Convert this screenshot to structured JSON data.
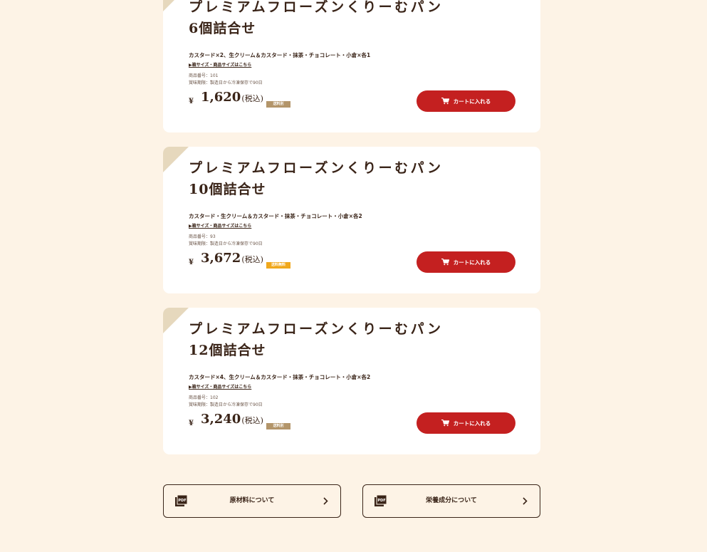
{
  "products": [
    {
      "title_line1": "プレミアムフローズンくりーむパン",
      "title_line2": "6個詰合せ",
      "contents": "カスタード×2、生クリーム＆カスタード・抹茶・チョコレート・小倉×各1",
      "size_link": "▶箱サイズ・商品サイズはこちら",
      "code": "商品番号：101",
      "expiry": "賞味期限：製造日から冷凍保存で90日",
      "yen": "¥",
      "price": "1,620",
      "tax": "(税込)",
      "badge": "送料別",
      "badge_color": "#b3956a",
      "cart_label": "カートに入れる"
    },
    {
      "title_line1": "プレミアムフローズンくりーむパン",
      "title_line2": "10個詰合せ",
      "contents": "カスタード・生クリーム＆カスタード・抹茶・チョコレート・小倉×各2",
      "size_link": "▶箱サイズ・商品サイズはこちら",
      "code": "商品番号：93",
      "expiry": "賞味期限：製造日から冷凍保存で90日",
      "yen": "¥",
      "price": "3,672",
      "tax": "(税込)",
      "badge": "送料無料",
      "badge_color": "#f0a81c",
      "cart_label": "カートに入れる"
    },
    {
      "title_line1": "プレミアムフローズンくりーむパン",
      "title_line2": "12個詰合せ",
      "contents": "カスタード×4、生クリーム＆カスタード・抹茶・チョコレート・小倉×各2",
      "size_link": "▶箱サイズ・商品サイズはこちら",
      "code": "商品番号：102",
      "expiry": "賞味期限：製造日から冷凍保存で90日",
      "yen": "¥",
      "price": "3,240",
      "tax": "(税込)",
      "badge": "送料別",
      "badge_color": "#b3956a",
      "cart_label": "カートに入れる"
    }
  ],
  "footer_buttons": [
    {
      "label": "原材料について",
      "icon": "pdf-icon"
    },
    {
      "label": "栄養成分について",
      "icon": "pdf-icon"
    }
  ],
  "colors": {
    "background": "#fdf3e6",
    "card": "#ffffff",
    "accent_red": "#c42020",
    "corner": "#e6d8bd",
    "text": "#3a2418"
  }
}
